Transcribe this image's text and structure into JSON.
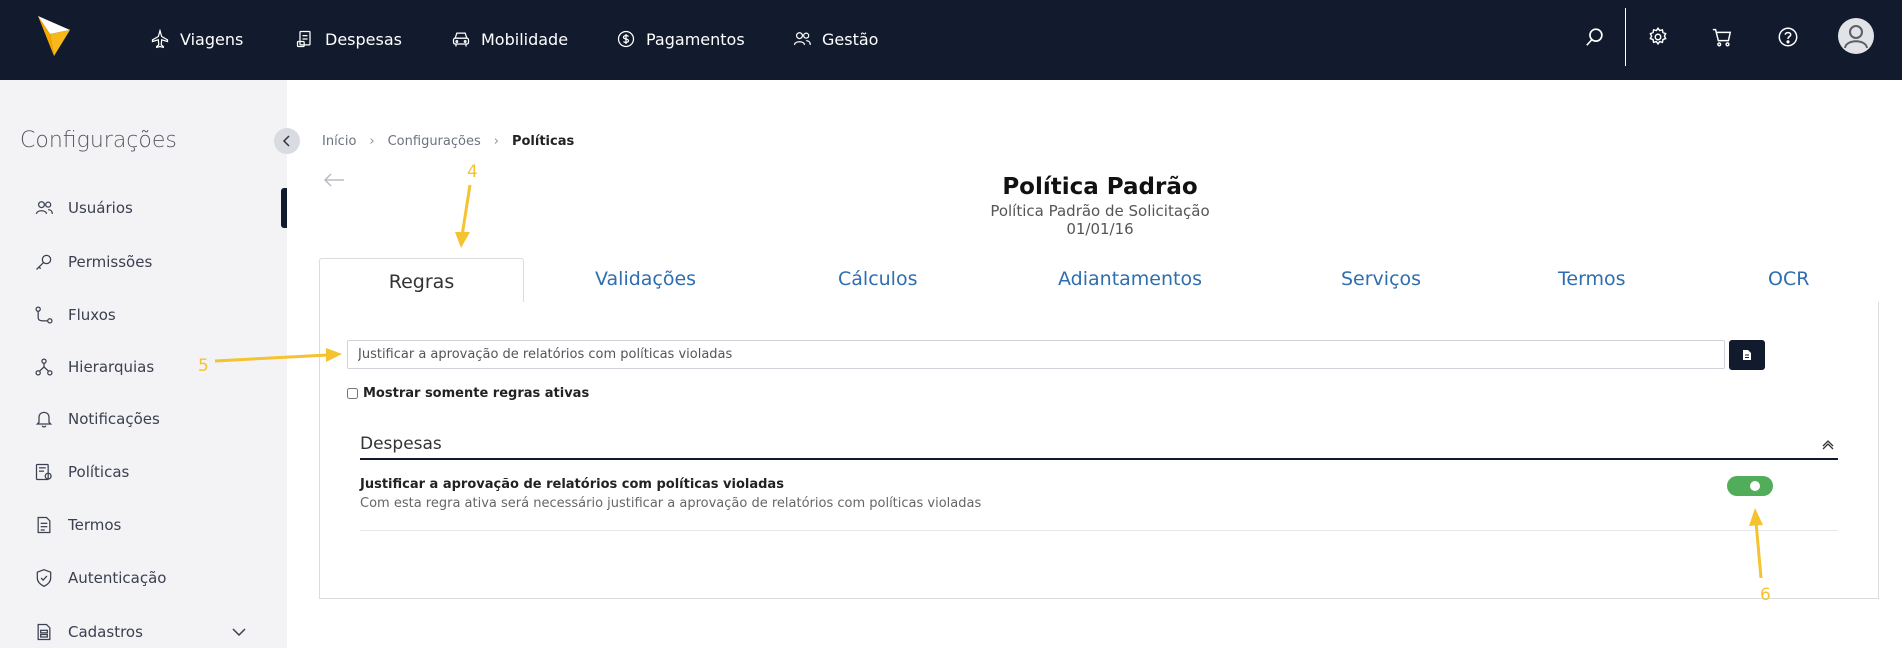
{
  "nav": {
    "items": [
      {
        "label": "Viagens",
        "icon": "airplane-icon"
      },
      {
        "label": "Despesas",
        "icon": "receipt-icon"
      },
      {
        "label": "Mobilidade",
        "icon": "car-icon"
      },
      {
        "label": "Pagamentos",
        "icon": "dollar-coin-icon"
      },
      {
        "label": "Gestão",
        "icon": "people-icon"
      }
    ],
    "right_icons": [
      "search-icon",
      "gear-icon",
      "cart-icon",
      "help-icon",
      "avatar"
    ]
  },
  "sidebar": {
    "title": "Configurações",
    "items": [
      {
        "label": "Usuários",
        "icon": "users-icon"
      },
      {
        "label": "Permissões",
        "icon": "key-icon"
      },
      {
        "label": "Fluxos",
        "icon": "flow-icon"
      },
      {
        "label": "Hierarquias",
        "icon": "hierarchy-icon"
      },
      {
        "label": "Notificações",
        "icon": "bell-icon"
      },
      {
        "label": "Políticas",
        "icon": "policy-icon"
      },
      {
        "label": "Termos",
        "icon": "document-icon"
      },
      {
        "label": "Autenticação",
        "icon": "shield-check-icon"
      },
      {
        "label": "Cadastros",
        "icon": "file-list-icon"
      }
    ]
  },
  "breadcrumb": {
    "items": [
      "Início",
      "Configurações",
      "Políticas"
    ]
  },
  "page": {
    "title": "Política Padrão",
    "subtitle": "Política Padrão de Solicitação",
    "date": "01/01/16"
  },
  "tabs": [
    "Regras",
    "Validações",
    "Cálculos",
    "Adiantamentos",
    "Serviços",
    "Termos",
    "OCR"
  ],
  "search": {
    "value": "Justificar a aprovação de relatórios com políticas violadas"
  },
  "filter": {
    "label": "Mostrar somente regras ativas"
  },
  "section": {
    "title": "Despesas"
  },
  "rule": {
    "title": "Justificar a aprovação de relatórios com políticas violadas",
    "description": "Com esta regra ativa será necessário justificar a aprovação de relatórios com políticas violadas",
    "enabled": true
  },
  "annotations": [
    "4",
    "5",
    "6"
  ],
  "colors": {
    "nav_bg": "#121b2d",
    "accent_blue": "#2f6eae",
    "toggle_on": "#52ad5b",
    "annotation": "#f5c230",
    "logo_yellow": "#f7b81b"
  }
}
